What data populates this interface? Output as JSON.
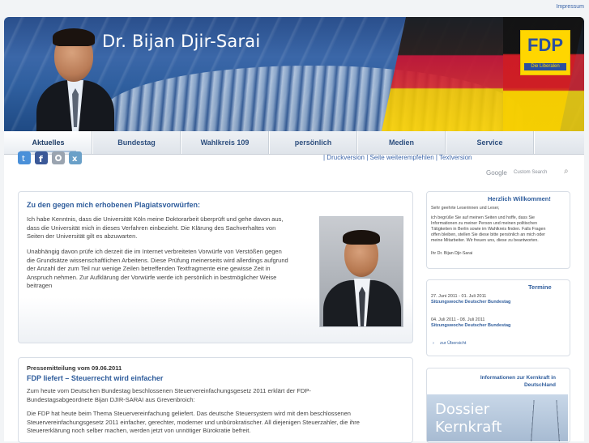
{
  "impressum": "Impressum",
  "banner": {
    "title": "Dr. Bijan Djir-Sarai",
    "logo_main": "FDP",
    "logo_sub": "Die Liberalen"
  },
  "nav": [
    "Aktuelles",
    "Bundestag",
    "Wahlkreis 109",
    "persönlich",
    "Medien",
    "Service"
  ],
  "social": {
    "icons": [
      "twitter-icon",
      "facebook-icon",
      "network-icon",
      "xing-icon"
    ],
    "colors": [
      "#4a90d9",
      "#3b5998",
      "#9aa4b0",
      "#6aa0c8"
    ]
  },
  "tools": "| Druckversion | Seite weiterempfehlen | Textversion",
  "search": {
    "brand": "Google",
    "sub": "Custom Search"
  },
  "article1": {
    "title": "Zu den gegen mich erhobenen Plagiatsvorwürfen:",
    "p1": [
      "Ich habe Kenntnis, dass die Universität Köln meine Doktorarbeit überprüft und gehe davon aus,",
      "dass die Universität mich in dieses Verfahren einbezieht. Die Klärung des Sachverhaltes von",
      "Seiten der Universität gilt es abzuwarten."
    ],
    "p2": [
      "Unabhängig davon prüfe ich derzeit die im Internet verbreiteten Vorwürfe von Verstößen gegen",
      "die Grundsätze wissenschaftlichen Arbeitens. Diese Prüfung meinerseits wird allerdings aufgrund",
      "der Anzahl der zum Teil nur wenige Zeilen betreffenden Textfragmente eine gewisse Zeit in",
      "Anspruch nehmen. Zur Aufklärung der Vorwürfe werde ich persönlich in bestmöglicher Weise",
      "beitragen"
    ]
  },
  "article2": {
    "kicker": "Pressemitteilung vom 09.06.2011",
    "title": "FDP liefert – Steuerrecht wird einfacher",
    "p1": [
      "Zum heute vom Deutschen Bundestag beschlossenen Steuervereinfachungsgesetz 2011 erklärt der FDP-",
      "Bundestagsabgeordnete Bijan DJIR-SARAI aus Grevenbroich:"
    ],
    "p2": [
      "Die FDP hat heute beim Thema Steuervereinfachung geliefert. Das deutsche Steuersystem wird mit dem beschlossenen",
      "Steuervereinfachungsgesetz 2011 einfacher, gerechter, moderner und unbürokratischer. All diejenigen Steuerzahler, die ihre",
      "Steuererklärung noch selber machen, werden jetzt von unnötiger Bürokratie befreit."
    ]
  },
  "welcome": {
    "title": "Herzlich Willkommen!",
    "greeting": "Sehr geehrte Leserinnen und Leser,",
    "body": [
      "ich begrüße Sie auf meinen Seiten und hoffe, dass Sie",
      "Informationen zu meiner Person und meinen politischen",
      "Tätigkeiten in Berlin sowie im Wahlkreis finden. Falls Fragen",
      "offen bleiben, stellen Sie diese bitte persönlich an mich oder",
      "meine Mitarbeiter. Wir freuen uns, diese zu beantworten."
    ],
    "sign": "Ihr Dr. Bijan Djir-Sarai"
  },
  "termine": {
    "title": "Termine",
    "items": [
      {
        "date": "27. Juni 2011 - 01. Juli 2011",
        "label": "Sitzungswoche Deutscher Bundestag"
      },
      {
        "date": "04. Juli 2011 - 08. Juli 2011",
        "label": "Sitzungswoche Deutscher Bundestag"
      }
    ],
    "link": "zur Übersicht"
  },
  "kernkraft": {
    "title": "Informationen zur Kernkraft in Deutschland",
    "line1": "Dossier",
    "line2": "Kernkraft"
  }
}
